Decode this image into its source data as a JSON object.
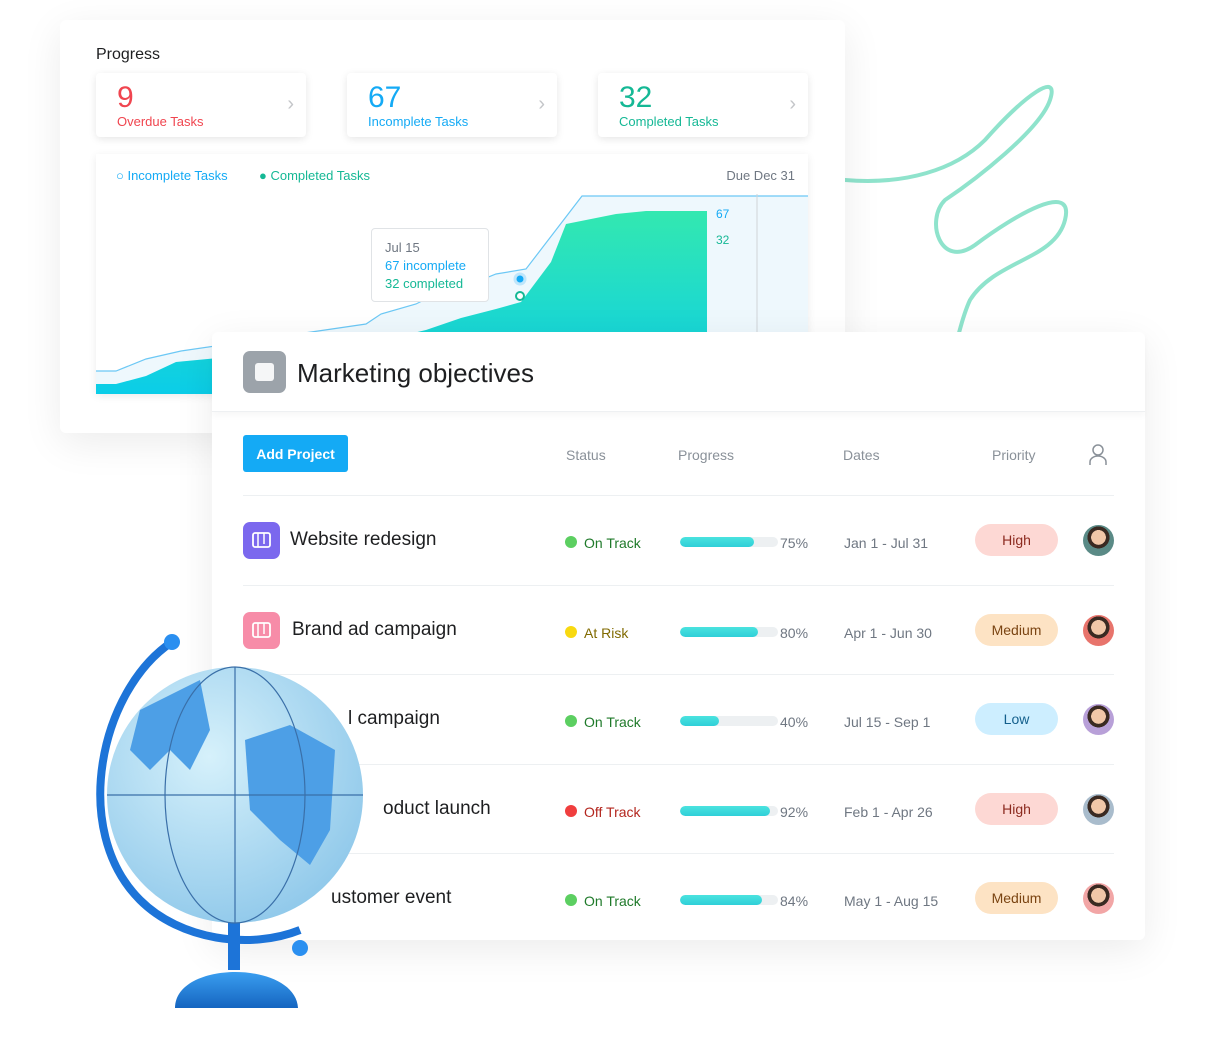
{
  "progress": {
    "title": "Progress",
    "stats": [
      {
        "value": "9",
        "label": "Overdue Tasks",
        "color": "#f0454f"
      },
      {
        "value": "67",
        "label": "Incomplete Tasks",
        "color": "#14aaf5"
      },
      {
        "value": "32",
        "label": "Completed Tasks",
        "color": "#15b895"
      }
    ],
    "chart": {
      "legend": [
        "Incomplete Tasks",
        "Completed Tasks"
      ],
      "due": "Due Dec 31",
      "end_incomplete": "67",
      "end_completed": "32",
      "tooltip": {
        "date": "Jul 15",
        "incomplete": "67 incomplete",
        "completed": "32 completed"
      }
    }
  },
  "main": {
    "title": "Marketing objectives",
    "add_button": "Add Project",
    "columns": [
      "Status",
      "Progress",
      "Dates",
      "Priority"
    ],
    "rows": [
      {
        "name": "Website redesign",
        "icon": "board-icon",
        "icon_color": "#7b68ee",
        "status": "On Track",
        "status_color": "#5ccf61",
        "status_text": "#1f7a2a",
        "progress": 75,
        "progress_label": "75%",
        "dates": "Jan 1 - Jul 31",
        "priority": "High",
        "avatar": "#5a8a86"
      },
      {
        "name": "Brand ad campaign",
        "icon": "list-icon",
        "icon_color": "#f78ca8",
        "status": "At Risk",
        "status_color": "#f8d910",
        "status_text": "#806a00",
        "progress": 80,
        "progress_label": "80%",
        "dates": "Apr 1 - Jun 30",
        "priority": "Medium",
        "avatar": "#e8746c"
      },
      {
        "name": "l campaign",
        "icon": "",
        "icon_color": "",
        "status": "On Track",
        "status_color": "#5ccf61",
        "status_text": "#1f7a2a",
        "progress": 40,
        "progress_label": "40%",
        "dates": "Jul 15 - Sep 1",
        "priority": "Low",
        "avatar": "#b8a0d8"
      },
      {
        "name": "oduct launch",
        "icon": "",
        "icon_color": "",
        "status": "Off Track",
        "status_color": "#f03e3e",
        "status_text": "#b3261e",
        "progress": 92,
        "progress_label": "92%",
        "dates": "Feb 1 - Apr 26",
        "priority": "High",
        "avatar": "#a9bccc"
      },
      {
        "name": "ustomer event",
        "icon": "",
        "icon_color": "",
        "status": "On Track",
        "status_color": "#5ccf61",
        "status_text": "#1f7a2a",
        "progress": 84,
        "progress_label": "84%",
        "dates": "May 1 - Aug 15",
        "priority": "Medium",
        "avatar": "#f2a6a6"
      }
    ]
  },
  "priority_colors": {
    "High": [
      "#fdd8d4",
      "#8c2a1f"
    ],
    "Medium": [
      "#fde3c4",
      "#7a4412"
    ],
    "Low": [
      "#cdeeff",
      "#135f8c"
    ]
  }
}
